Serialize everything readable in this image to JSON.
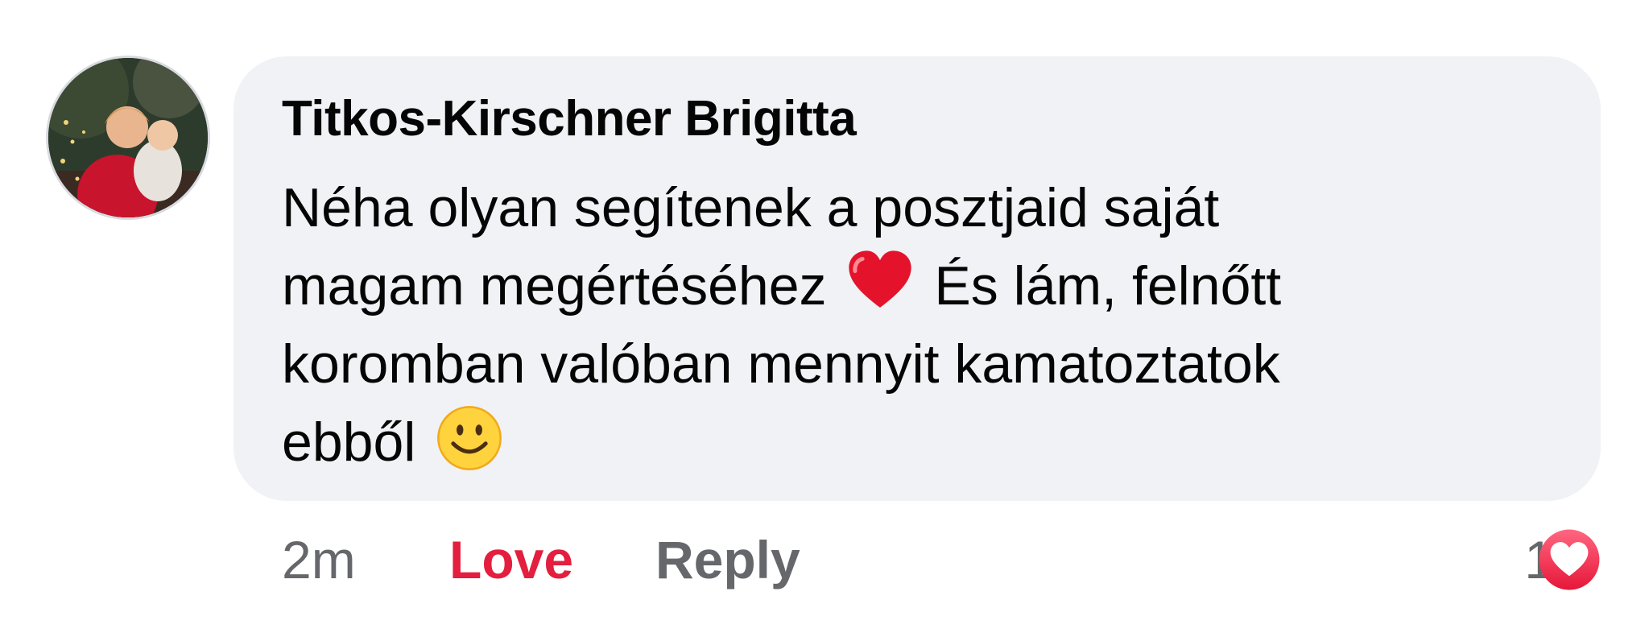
{
  "comment": {
    "author": "Titkos-Kirschner Brigitta",
    "lines": [
      "Néha olyan segítenek a posztjaid saját",
      "magam megértéséhez",
      "És lám, felnőtt",
      "koromban valóban mennyit kamatoztatok",
      "ebből"
    ],
    "emojis": [
      "red-heart-emoji",
      "slightly-smiling-face-emoji"
    ],
    "bubble_color": "#f0f2f5"
  },
  "actions": {
    "time": "2m",
    "love_label": "Love",
    "reply_label": "Reply",
    "love_color": "#e41e3f",
    "muted_color": "#65676b"
  },
  "reactions": {
    "count": "1",
    "icon": "love-reaction-icon",
    "color": "#f02849"
  }
}
